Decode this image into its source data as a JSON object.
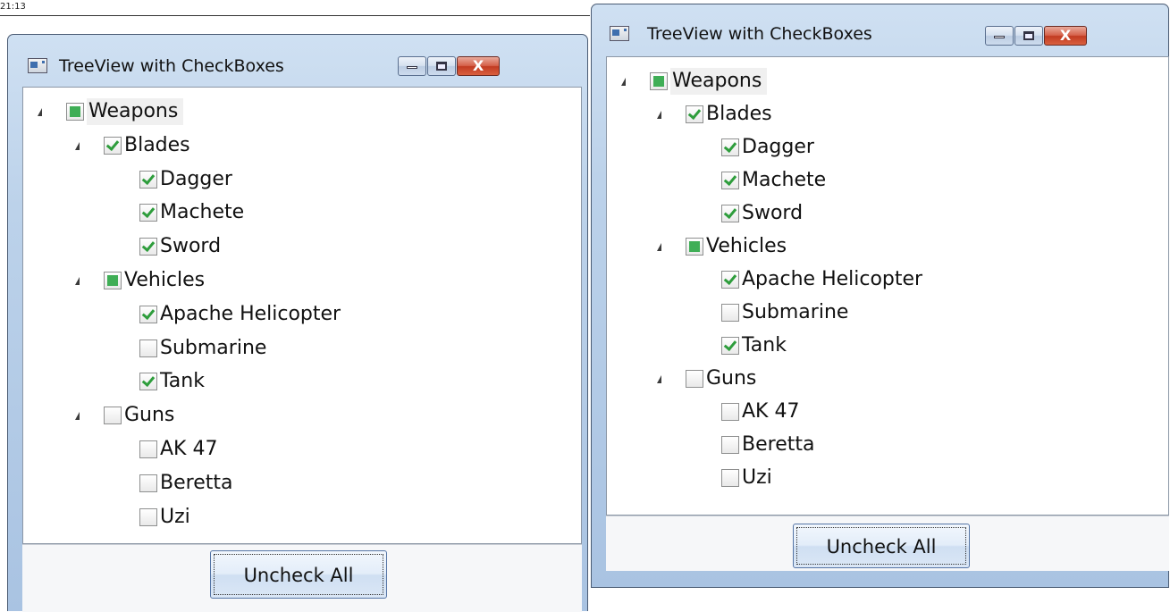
{
  "timestamp": "21:13",
  "windows": [
    {
      "title": "TreeView with CheckBoxes",
      "close_glyph": "X",
      "button_label": "Uncheck All",
      "tree": [
        {
          "label": "Weapons",
          "state": "partial",
          "level": 0,
          "expanded": true
        },
        {
          "label": "Blades",
          "state": "checked",
          "level": 1,
          "expanded": true
        },
        {
          "label": "Dagger",
          "state": "checked",
          "level": 2
        },
        {
          "label": "Machete",
          "state": "checked",
          "level": 2
        },
        {
          "label": "Sword",
          "state": "checked",
          "level": 2
        },
        {
          "label": "Vehicles",
          "state": "partial",
          "level": 1,
          "expanded": true
        },
        {
          "label": "Apache Helicopter",
          "state": "checked",
          "level": 2
        },
        {
          "label": "Submarine",
          "state": "unchecked",
          "level": 2
        },
        {
          "label": "Tank",
          "state": "checked",
          "level": 2
        },
        {
          "label": "Guns",
          "state": "unchecked",
          "level": 1,
          "expanded": true
        },
        {
          "label": "AK 47",
          "state": "unchecked",
          "level": 2
        },
        {
          "label": "Beretta",
          "state": "unchecked",
          "level": 2
        },
        {
          "label": "Uzi",
          "state": "unchecked",
          "level": 2
        }
      ]
    },
    {
      "title": "TreeView with CheckBoxes",
      "close_glyph": "X",
      "button_label": "Uncheck All",
      "tree": [
        {
          "label": "Weapons",
          "state": "partial",
          "level": 0,
          "expanded": true
        },
        {
          "label": "Blades",
          "state": "checked",
          "level": 1,
          "expanded": true
        },
        {
          "label": "Dagger",
          "state": "checked",
          "level": 2
        },
        {
          "label": "Machete",
          "state": "checked",
          "level": 2
        },
        {
          "label": "Sword",
          "state": "checked",
          "level": 2
        },
        {
          "label": "Vehicles",
          "state": "partial",
          "level": 1,
          "expanded": true
        },
        {
          "label": "Apache Helicopter",
          "state": "checked",
          "level": 2
        },
        {
          "label": "Submarine",
          "state": "unchecked",
          "level": 2
        },
        {
          "label": "Tank",
          "state": "checked",
          "level": 2
        },
        {
          "label": "Guns",
          "state": "unchecked",
          "level": 1,
          "expanded": true
        },
        {
          "label": "AK 47",
          "state": "unchecked",
          "level": 2
        },
        {
          "label": "Beretta",
          "state": "unchecked",
          "level": 2
        },
        {
          "label": "Uzi",
          "state": "unchecked",
          "level": 2
        }
      ]
    }
  ]
}
